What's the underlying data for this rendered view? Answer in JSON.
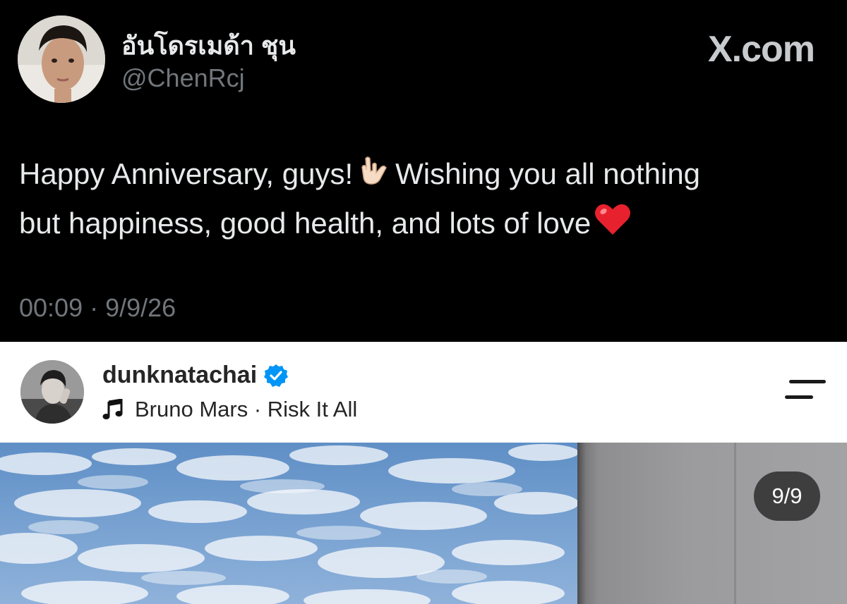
{
  "tweet": {
    "display_name": "อันโดรเมด้า ชุน",
    "handle": "@ChenRcj",
    "brand": "X.com",
    "text_line1_a": "Happy Anniversary, guys!",
    "text_line1_b": "Wishing you all nothing",
    "text_line2": "but happiness, good health, and lots of love",
    "emoji_1": "love-you-gesture-icon",
    "emoji_2": "red-heart-icon",
    "timestamp": "00:09 · 9/9/26",
    "colors": {
      "background": "#000000",
      "text": "#e7e9ea",
      "secondary": "#71767b"
    }
  },
  "instagram": {
    "username": "dunknatachai",
    "verified": true,
    "music_icon": "music-note-icon",
    "music": "Bruno Mars · Risk It All",
    "menu_icon": "menu-icon",
    "carousel_counter": "9/9",
    "colors": {
      "background": "#ffffff",
      "text": "#262626",
      "verified_badge": "#0095f6"
    }
  }
}
